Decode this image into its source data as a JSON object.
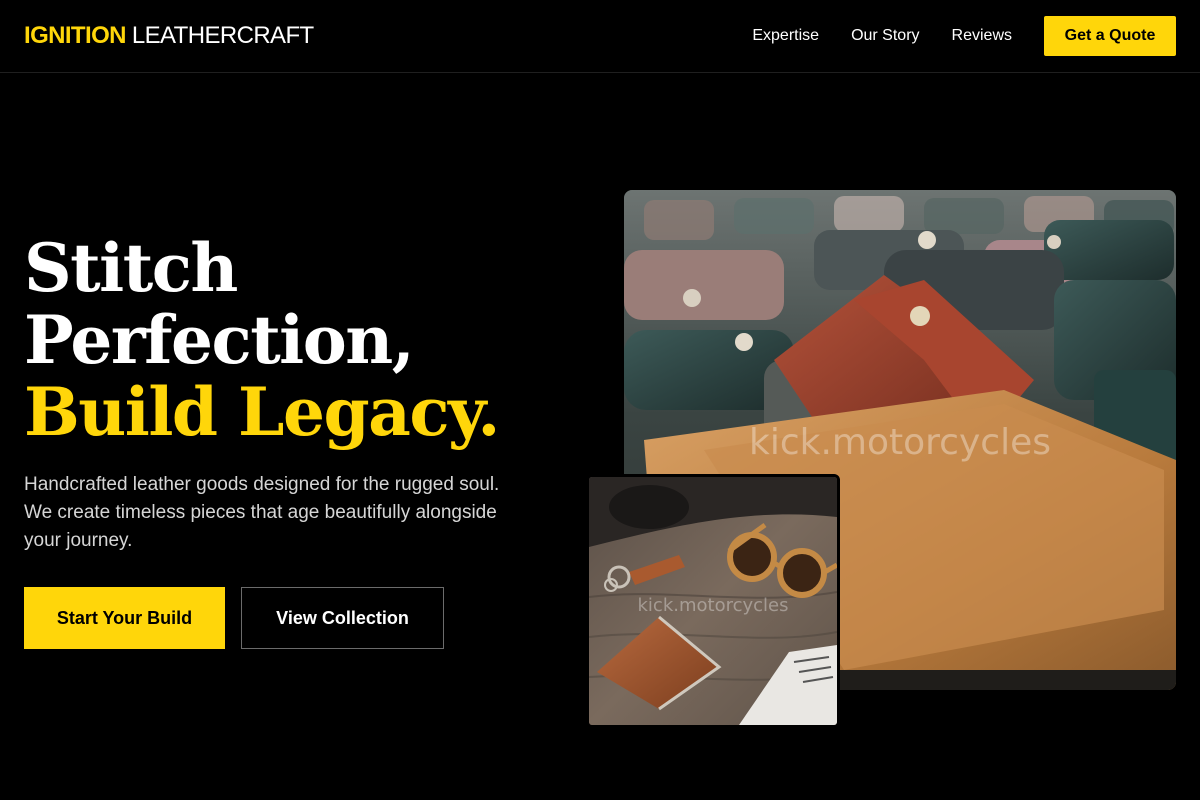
{
  "brand": {
    "name_strong": "IGNITION",
    "name_light": "LEATHERCRAFT"
  },
  "nav": {
    "links": [
      "Expertise",
      "Our Story",
      "Reviews"
    ],
    "cta": "Get a Quote"
  },
  "hero": {
    "title_line1": "Stitch",
    "title_line2": "Perfection,",
    "title_accent": "Build Legacy.",
    "subtitle": "Handcrafted leather goods designed for the rugged soul. We create timeless pieces that age beautifully alongside your journey.",
    "primary_cta": "Start Your Build",
    "secondary_cta": "View Collection"
  },
  "images": {
    "main_watermark": "kick.motorcycles",
    "inset_watermark": "kick.motorcycles"
  },
  "colors": {
    "accent": "#FFD60A",
    "background": "#000000",
    "text": "#FFFFFF"
  }
}
